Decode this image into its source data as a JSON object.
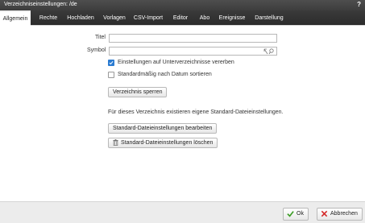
{
  "dialog": {
    "title": "Verzeichniseinstellungen: /de",
    "help": "?"
  },
  "tabs": [
    {
      "label": "Allgemein",
      "active": true
    },
    {
      "label": "Rechte"
    },
    {
      "label": "Hochladen"
    },
    {
      "label": "Vorlagen"
    },
    {
      "label": "CSV-Import"
    },
    {
      "label": "Editor"
    },
    {
      "label": "Abo"
    },
    {
      "label": "Ereignisse"
    },
    {
      "label": "Darstellung"
    }
  ],
  "form": {
    "title_label": "Titel",
    "title_value": "",
    "symbol_label": "Symbol",
    "symbol_value": "",
    "inherit_label": "Einstellungen auf Unterverzeichnisse vererben",
    "inherit_checked": true,
    "sort_label": "Standardmäßig nach Datum sortieren",
    "sort_checked": false,
    "lock_button": "Verzeichnis sperren",
    "info_text": "Für dieses Verzeichnis existieren eigene Standard-Dateieinstellungen.",
    "edit_button": "Standard-Dateieinstellungen bearbeiten",
    "delete_button": "Standard-Dateieinstellungen löschen"
  },
  "footer": {
    "ok_label": "Ok",
    "cancel_label": "Abbrechen"
  },
  "colors": {
    "checkbox": "#2b7bd1",
    "ok_icon": "#3a9d23",
    "cancel_icon": "#d42a2a"
  }
}
